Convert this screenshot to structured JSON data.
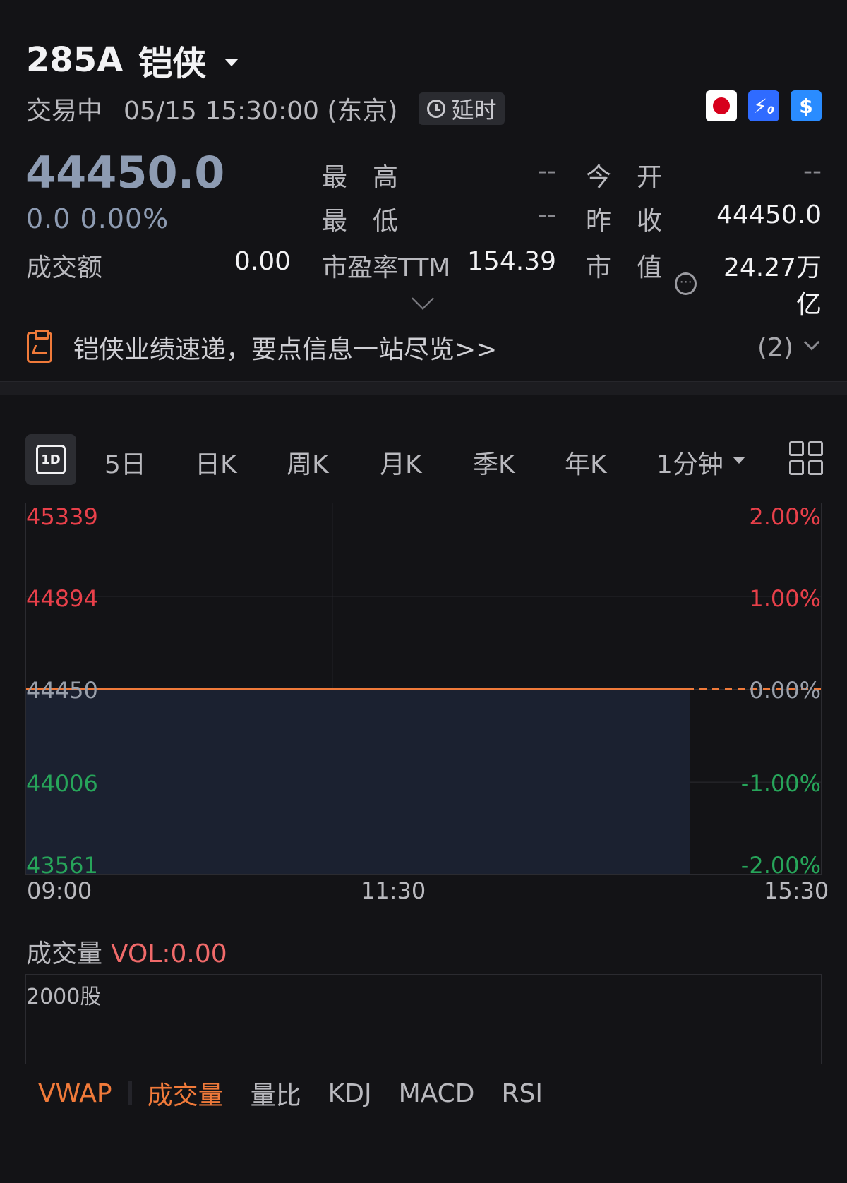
{
  "header": {
    "code": "285A",
    "name": "铠侠",
    "status": "交易中",
    "datetime": "05/15 15:30:00 (东京)",
    "delay_label": "延时",
    "icons": [
      "japan-flag-icon",
      "lightning-icon",
      "dollar-icon"
    ],
    "icon_bolt_text": "⚡",
    "icon_bolt_sub": "0",
    "icon_dollar_text": "$"
  },
  "quote": {
    "price": "44450.0",
    "change": "0.0",
    "change_pct": "0.00%",
    "turnover_label": "成交额",
    "turnover_value": "0.00",
    "high_label": "最　高",
    "high_value": "--",
    "low_label": "最　低",
    "low_value": "--",
    "pe_label": "市盈率TTM",
    "pe_value": "154.39",
    "open_label": "今　开",
    "open_value": "--",
    "prev_close_label": "昨　收",
    "prev_close_value": "44450.0",
    "mktcap_label": "市　值",
    "mktcap_value": "24.27万亿",
    "mktcap_icon": "⋯"
  },
  "notice": {
    "text": "铠侠业绩速递，要点信息一站尽览>>",
    "count": "(2)"
  },
  "tabs": {
    "active": "1D",
    "items": [
      "5日",
      "日K",
      "周K",
      "月K",
      "季K",
      "年K"
    ],
    "interval": "1分钟"
  },
  "colors": {
    "up": "#e8404a",
    "down": "#27a55a",
    "accent": "#f07a3a",
    "area_fill": "#1b2130"
  },
  "chart_data": {
    "type": "line",
    "title": "",
    "xlabel": "",
    "ylabel": "",
    "x_ticks": [
      "09:00",
      "11:30",
      "15:30"
    ],
    "y_ticks_left": [
      "45339",
      "44894",
      "44450",
      "44006",
      "43561"
    ],
    "y_ticks_right": [
      "2.00%",
      "1.00%",
      "0.00%",
      "-1.00%",
      "-2.00%"
    ],
    "ylim": [
      43561,
      45339
    ],
    "reference_line": 44450,
    "series": [
      {
        "x": [
          "09:00",
          "14:25"
        ],
        "values": [
          44450,
          44450
        ]
      }
    ]
  },
  "volume": {
    "label": "成交量",
    "vol_text": "VOL:0.00",
    "scale_label": "2000股"
  },
  "indicators": {
    "items": [
      "VWAP",
      "成交量",
      "量比",
      "KDJ",
      "MACD",
      "RSI"
    ],
    "active": [
      "VWAP",
      "成交量"
    ]
  }
}
